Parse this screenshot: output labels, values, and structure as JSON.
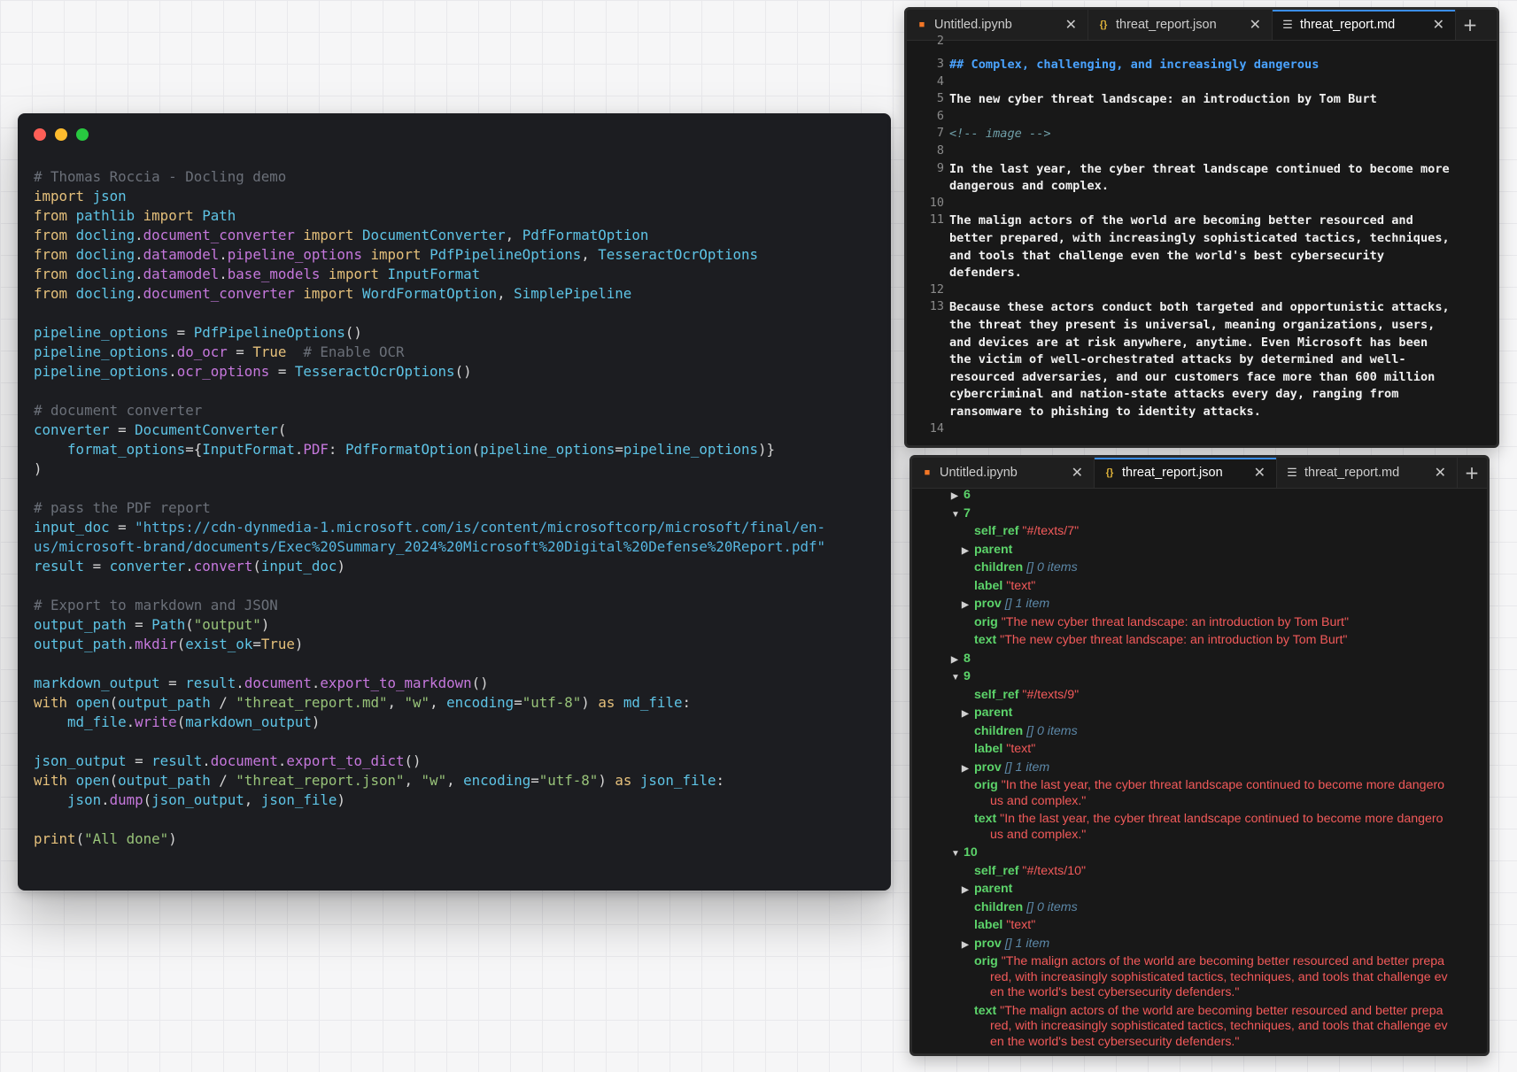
{
  "code_window": {
    "lines": [
      [
        [
          "c-com",
          "# Thomas Roccia - Docling demo"
        ]
      ],
      [
        [
          "c-kw",
          "import"
        ],
        [
          "c-p",
          " "
        ],
        [
          "c-id",
          "json"
        ]
      ],
      [
        [
          "c-kw",
          "from"
        ],
        [
          "c-p",
          " "
        ],
        [
          "c-id",
          "pathlib"
        ],
        [
          "c-p",
          " "
        ],
        [
          "c-kw",
          "import"
        ],
        [
          "c-p",
          " "
        ],
        [
          "c-id",
          "Path"
        ]
      ],
      [
        [
          "c-kw",
          "from"
        ],
        [
          "c-p",
          " "
        ],
        [
          "c-id",
          "docling"
        ],
        [
          "c-p",
          "."
        ],
        [
          "c-mod",
          "document_converter"
        ],
        [
          "c-p",
          " "
        ],
        [
          "c-kw",
          "import"
        ],
        [
          "c-p",
          " "
        ],
        [
          "c-id",
          "DocumentConverter"
        ],
        [
          "c-p",
          ", "
        ],
        [
          "c-id",
          "PdfFormatOption"
        ]
      ],
      [
        [
          "c-kw",
          "from"
        ],
        [
          "c-p",
          " "
        ],
        [
          "c-id",
          "docling"
        ],
        [
          "c-p",
          "."
        ],
        [
          "c-mod",
          "datamodel"
        ],
        [
          "c-p",
          "."
        ],
        [
          "c-mod",
          "pipeline_options"
        ],
        [
          "c-p",
          " "
        ],
        [
          "c-kw",
          "import"
        ],
        [
          "c-p",
          " "
        ],
        [
          "c-id",
          "PdfPipelineOptions"
        ],
        [
          "c-p",
          ", "
        ],
        [
          "c-id",
          "TesseractOcrOptions"
        ]
      ],
      [
        [
          "c-kw",
          "from"
        ],
        [
          "c-p",
          " "
        ],
        [
          "c-id",
          "docling"
        ],
        [
          "c-p",
          "."
        ],
        [
          "c-mod",
          "datamodel"
        ],
        [
          "c-p",
          "."
        ],
        [
          "c-mod",
          "base_models"
        ],
        [
          "c-p",
          " "
        ],
        [
          "c-kw",
          "import"
        ],
        [
          "c-p",
          " "
        ],
        [
          "c-id",
          "InputFormat"
        ]
      ],
      [
        [
          "c-kw",
          "from"
        ],
        [
          "c-p",
          " "
        ],
        [
          "c-id",
          "docling"
        ],
        [
          "c-p",
          "."
        ],
        [
          "c-mod",
          "document_converter"
        ],
        [
          "c-p",
          " "
        ],
        [
          "c-kw",
          "import"
        ],
        [
          "c-p",
          " "
        ],
        [
          "c-id",
          "WordFormatOption"
        ],
        [
          "c-p",
          ", "
        ],
        [
          "c-id",
          "SimplePipeline"
        ]
      ],
      [],
      [
        [
          "c-id",
          "pipeline_options"
        ],
        [
          "c-p",
          " = "
        ],
        [
          "c-id",
          "PdfPipelineOptions"
        ],
        [
          "c-p",
          "()"
        ]
      ],
      [
        [
          "c-id",
          "pipeline_options"
        ],
        [
          "c-p",
          "."
        ],
        [
          "c-mod",
          "do_ocr"
        ],
        [
          "c-p",
          " = "
        ],
        [
          "c-kw",
          "True"
        ],
        [
          "c-p",
          "  "
        ],
        [
          "c-com",
          "# Enable OCR"
        ]
      ],
      [
        [
          "c-id",
          "pipeline_options"
        ],
        [
          "c-p",
          "."
        ],
        [
          "c-mod",
          "ocr_options"
        ],
        [
          "c-p",
          " = "
        ],
        [
          "c-id",
          "TesseractOcrOptions"
        ],
        [
          "c-p",
          "()"
        ]
      ],
      [],
      [
        [
          "c-com",
          "# document converter"
        ]
      ],
      [
        [
          "c-id",
          "converter"
        ],
        [
          "c-p",
          " = "
        ],
        [
          "c-id",
          "DocumentConverter"
        ],
        [
          "c-p",
          "("
        ]
      ],
      [
        [
          "c-p",
          "    "
        ],
        [
          "c-id",
          "format_options"
        ],
        [
          "c-p",
          "={"
        ],
        [
          "c-id",
          "InputFormat"
        ],
        [
          "c-p",
          "."
        ],
        [
          "c-mod",
          "PDF"
        ],
        [
          "c-p",
          ": "
        ],
        [
          "c-id",
          "PdfFormatOption"
        ],
        [
          "c-p",
          "("
        ],
        [
          "c-id",
          "pipeline_options"
        ],
        [
          "c-p",
          "="
        ],
        [
          "c-id",
          "pipeline_options"
        ],
        [
          "c-p",
          ")}"
        ]
      ],
      [
        [
          "c-p",
          ")"
        ]
      ],
      [],
      [
        [
          "c-com",
          "# pass the PDF report"
        ]
      ],
      [
        [
          "c-id",
          "input_doc"
        ],
        [
          "c-p",
          " = "
        ],
        [
          "c-url",
          "\"https://cdn-dynmedia-1.microsoft.com/is/content/microsoftcorp/microsoft/final/en-"
        ]
      ],
      [
        [
          "c-url",
          "us/microsoft-brand/documents/Exec%20Summary_2024%20Microsoft%20Digital%20Defense%20Report.pdf\""
        ]
      ],
      [
        [
          "c-id",
          "result"
        ],
        [
          "c-p",
          " = "
        ],
        [
          "c-id",
          "converter"
        ],
        [
          "c-p",
          "."
        ],
        [
          "c-mod",
          "convert"
        ],
        [
          "c-p",
          "("
        ],
        [
          "c-id",
          "input_doc"
        ],
        [
          "c-p",
          ")"
        ]
      ],
      [],
      [
        [
          "c-com",
          "# Export to markdown and JSON"
        ]
      ],
      [
        [
          "c-id",
          "output_path"
        ],
        [
          "c-p",
          " = "
        ],
        [
          "c-id",
          "Path"
        ],
        [
          "c-p",
          "("
        ],
        [
          "c-str",
          "\"output\""
        ],
        [
          "c-p",
          ")"
        ]
      ],
      [
        [
          "c-id",
          "output_path"
        ],
        [
          "c-p",
          "."
        ],
        [
          "c-mod",
          "mkdir"
        ],
        [
          "c-p",
          "("
        ],
        [
          "c-id",
          "exist_ok"
        ],
        [
          "c-p",
          "="
        ],
        [
          "c-kw",
          "True"
        ],
        [
          "c-p",
          ")"
        ]
      ],
      [],
      [
        [
          "c-id",
          "markdown_output"
        ],
        [
          "c-p",
          " = "
        ],
        [
          "c-id",
          "result"
        ],
        [
          "c-p",
          "."
        ],
        [
          "c-mod",
          "document"
        ],
        [
          "c-p",
          "."
        ],
        [
          "c-mod",
          "export_to_markdown"
        ],
        [
          "c-p",
          "()"
        ]
      ],
      [
        [
          "c-kw",
          "with"
        ],
        [
          "c-p",
          " "
        ],
        [
          "c-id",
          "open"
        ],
        [
          "c-p",
          "("
        ],
        [
          "c-id",
          "output_path"
        ],
        [
          "c-p",
          " / "
        ],
        [
          "c-str",
          "\"threat_report.md\""
        ],
        [
          "c-p",
          ", "
        ],
        [
          "c-str",
          "\"w\""
        ],
        [
          "c-p",
          ", "
        ],
        [
          "c-id",
          "encoding"
        ],
        [
          "c-p",
          "="
        ],
        [
          "c-str",
          "\"utf-8\""
        ],
        [
          "c-p",
          ") "
        ],
        [
          "c-kw",
          "as"
        ],
        [
          "c-p",
          " "
        ],
        [
          "c-id",
          "md_file"
        ],
        [
          "c-p",
          ":"
        ]
      ],
      [
        [
          "c-p",
          "    "
        ],
        [
          "c-id",
          "md_file"
        ],
        [
          "c-p",
          "."
        ],
        [
          "c-mod",
          "write"
        ],
        [
          "c-p",
          "("
        ],
        [
          "c-id",
          "markdown_output"
        ],
        [
          "c-p",
          ")"
        ]
      ],
      [],
      [
        [
          "c-id",
          "json_output"
        ],
        [
          "c-p",
          " = "
        ],
        [
          "c-id",
          "result"
        ],
        [
          "c-p",
          "."
        ],
        [
          "c-mod",
          "document"
        ],
        [
          "c-p",
          "."
        ],
        [
          "c-mod",
          "export_to_dict"
        ],
        [
          "c-p",
          "()"
        ]
      ],
      [
        [
          "c-kw",
          "with"
        ],
        [
          "c-p",
          " "
        ],
        [
          "c-id",
          "open"
        ],
        [
          "c-p",
          "("
        ],
        [
          "c-id",
          "output_path"
        ],
        [
          "c-p",
          " / "
        ],
        [
          "c-str",
          "\"threat_report.json\""
        ],
        [
          "c-p",
          ", "
        ],
        [
          "c-str",
          "\"w\""
        ],
        [
          "c-p",
          ", "
        ],
        [
          "c-id",
          "encoding"
        ],
        [
          "c-p",
          "="
        ],
        [
          "c-str",
          "\"utf-8\""
        ],
        [
          "c-p",
          ") "
        ],
        [
          "c-kw",
          "as"
        ],
        [
          "c-p",
          " "
        ],
        [
          "c-id",
          "json_file"
        ],
        [
          "c-p",
          ":"
        ]
      ],
      [
        [
          "c-p",
          "    "
        ],
        [
          "c-id",
          "json"
        ],
        [
          "c-p",
          "."
        ],
        [
          "c-mod",
          "dump"
        ],
        [
          "c-p",
          "("
        ],
        [
          "c-id",
          "json_output"
        ],
        [
          "c-p",
          ", "
        ],
        [
          "c-id",
          "json_file"
        ],
        [
          "c-p",
          ")"
        ]
      ],
      [],
      [
        [
          "c-kw",
          "print"
        ],
        [
          "c-p",
          "("
        ],
        [
          "c-str",
          "\"All done\""
        ],
        [
          "c-p",
          ")"
        ]
      ]
    ]
  },
  "md_editor": {
    "tabs": [
      {
        "label": "Untitled.ipynb",
        "icon": "notebook-icon",
        "active": false
      },
      {
        "label": "threat_report.json",
        "icon": "json-icon",
        "active": false
      },
      {
        "label": "threat_report.md",
        "icon": "markdown-icon",
        "active": true
      }
    ],
    "add_tab": "+",
    "top_number": "2",
    "lines": [
      {
        "n": "3",
        "rows": [
          "## Complex, challenging, and increasingly dangerous"
        ],
        "style": "h2"
      },
      {
        "n": "4",
        "rows": [
          ""
        ]
      },
      {
        "n": "5",
        "rows": [
          "The new cyber threat landscape: an introduction by Tom Burt"
        ]
      },
      {
        "n": "6",
        "rows": [
          ""
        ]
      },
      {
        "n": "7",
        "rows": [
          "<!-- image -->"
        ],
        "style": "comment"
      },
      {
        "n": "8",
        "rows": [
          ""
        ]
      },
      {
        "n": "9",
        "rows": [
          "In the last year, the cyber threat landscape continued to become more",
          "dangerous and complex."
        ]
      },
      {
        "n": "10",
        "rows": [
          ""
        ]
      },
      {
        "n": "11",
        "rows": [
          "The malign actors of the world are becoming better resourced and",
          "better prepared, with increasingly sophisticated tactics, techniques,",
          "and tools that challenge even the world's best cybersecurity",
          "defenders."
        ]
      },
      {
        "n": "12",
        "rows": [
          ""
        ]
      },
      {
        "n": "13",
        "rows": [
          "Because these actors conduct both targeted and opportunistic attacks,",
          "the threat they present is universal, meaning organizations, users,",
          "and devices are at risk anywhere, anytime. Even Microsoft has been",
          "the victim of well-orchestrated attacks by determined and well-",
          "resourced adversaries, and our customers face more than 600 million",
          "cybercriminal and nation-state attacks every day, ranging from",
          "ransomware to phishing to identity attacks."
        ]
      },
      {
        "n": "14",
        "rows": [
          ""
        ]
      }
    ]
  },
  "json_viewer": {
    "tabs": [
      {
        "label": "Untitled.ipynb",
        "icon": "notebook-icon",
        "active": false
      },
      {
        "label": "threat_report.json",
        "icon": "json-icon",
        "active": true
      },
      {
        "label": "threat_report.md",
        "icon": "markdown-icon",
        "active": false
      }
    ],
    "add_tab": "+",
    "nodes": [
      {
        "depth": 0,
        "arrow": "▶",
        "key": "6"
      },
      {
        "depth": 0,
        "arrow": "▼",
        "key": "7"
      },
      {
        "depth": 1,
        "key": "self_ref",
        "str": "\"#/texts/7\""
      },
      {
        "depth": 1,
        "arrow": "▶",
        "key": "parent"
      },
      {
        "depth": 1,
        "key": "children",
        "meta": "[] 0 items"
      },
      {
        "depth": 1,
        "key": "label",
        "str": "\"text\""
      },
      {
        "depth": 1,
        "arrow": "▶",
        "key": "prov",
        "meta": "[] 1 item"
      },
      {
        "depth": 1,
        "key": "orig",
        "str": "\"The new cyber threat landscape: an introduction by Tom Burt\""
      },
      {
        "depth": 1,
        "key": "text",
        "str": "\"The new cyber threat landscape: an introduction by Tom Burt\""
      },
      {
        "depth": 0,
        "arrow": "▶",
        "key": "8"
      },
      {
        "depth": 0,
        "arrow": "▼",
        "key": "9"
      },
      {
        "depth": 1,
        "key": "self_ref",
        "str": "\"#/texts/9\""
      },
      {
        "depth": 1,
        "arrow": "▶",
        "key": "parent"
      },
      {
        "depth": 1,
        "key": "children",
        "meta": "[] 0 items"
      },
      {
        "depth": 1,
        "key": "label",
        "str": "\"text\""
      },
      {
        "depth": 1,
        "arrow": "▶",
        "key": "prov",
        "meta": "[] 1 item"
      },
      {
        "depth": 1,
        "key": "orig",
        "wrap": [
          "\"In the last year, the cyber threat landscape continued to become more dangero",
          "us and complex.\""
        ]
      },
      {
        "depth": 1,
        "key": "text",
        "wrap": [
          "\"In the last year, the cyber threat landscape continued to become more dangero",
          "us and complex.\""
        ]
      },
      {
        "depth": 0,
        "arrow": "▼",
        "key": "10"
      },
      {
        "depth": 1,
        "key": "self_ref",
        "str": "\"#/texts/10\""
      },
      {
        "depth": 1,
        "arrow": "▶",
        "key": "parent"
      },
      {
        "depth": 1,
        "key": "children",
        "meta": "[] 0 items"
      },
      {
        "depth": 1,
        "key": "label",
        "str": "\"text\""
      },
      {
        "depth": 1,
        "arrow": "▶",
        "key": "prov",
        "meta": "[] 1 item"
      },
      {
        "depth": 1,
        "key": "orig",
        "wrap": [
          "\"The malign actors of the world are becoming better resourced and better prepa",
          "red, with increasingly sophisticated tactics, techniques, and tools that challenge ev",
          "en the world's best cybersecurity defenders.\""
        ]
      },
      {
        "depth": 1,
        "key": "text",
        "wrap": [
          "\"The malign actors of the world are becoming better resourced and better prepa",
          "red, with increasingly sophisticated tactics, techniques, and tools that challenge ev",
          "en the world's best cybersecurity defenders.\""
        ]
      }
    ]
  }
}
